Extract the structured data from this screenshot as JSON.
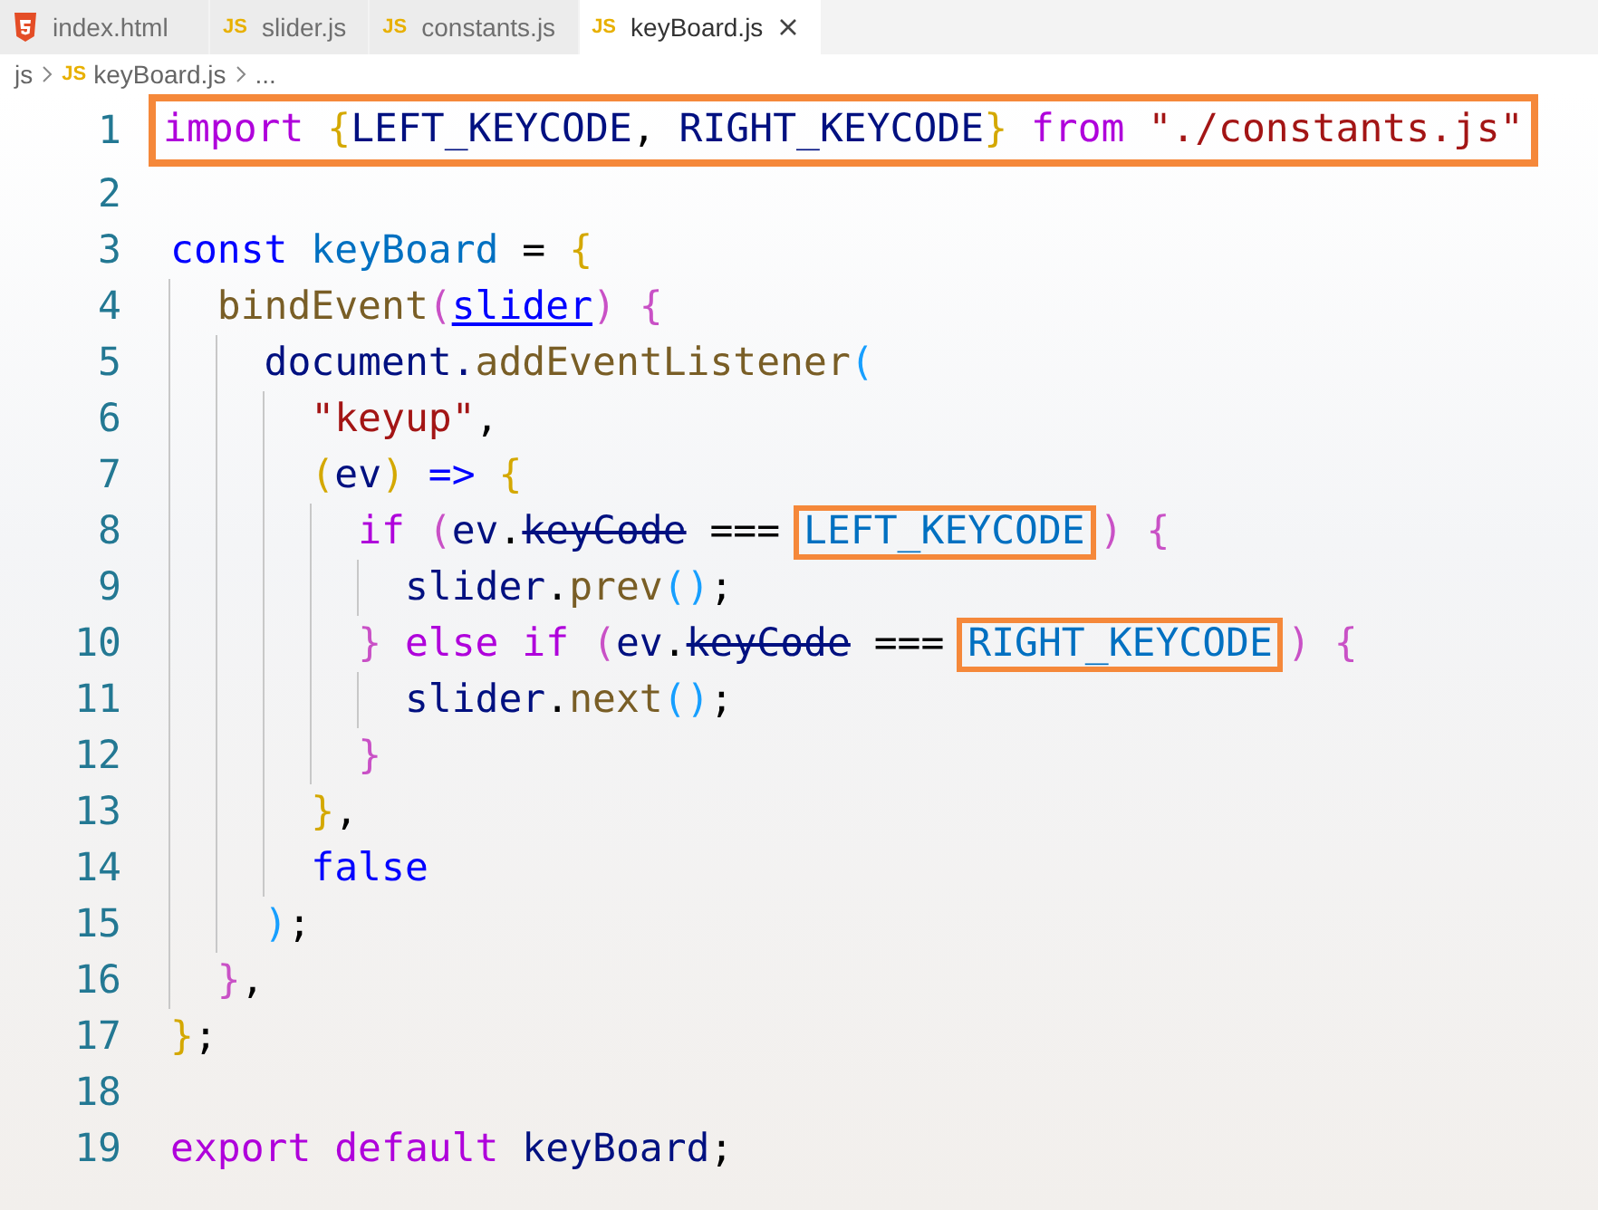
{
  "tabs": [
    {
      "label": "index.html",
      "kind": "html",
      "selected": false,
      "closable": false
    },
    {
      "label": "slider.js",
      "kind": "js",
      "badge": "JS",
      "selected": false,
      "closable": false
    },
    {
      "label": "constants.js",
      "kind": "js",
      "badge": "JS",
      "selected": false,
      "closable": false
    },
    {
      "label": "keyBoard.js",
      "kind": "js",
      "badge": "JS",
      "selected": true,
      "closable": true
    }
  ],
  "breadcrumb": [
    {
      "label": "js"
    },
    {
      "badge": "JS",
      "label": "keyBoard.js"
    },
    {
      "label": "..."
    }
  ],
  "lines": [
    {
      "number": "1",
      "highlighted": true,
      "tokens": [
        {
          "text": "import",
          "kind": "keyword"
        },
        {
          "text": " {",
          "kind": "bracket1"
        },
        {
          "text": "LEFT_KEYCODE",
          "kind": "variable"
        },
        {
          "text": ", ",
          "kind": "plain"
        },
        {
          "text": "RIGHT_KEYCODE",
          "kind": "variable"
        },
        {
          "text": "}",
          "kind": "bracket1"
        },
        {
          "text": " from",
          "kind": "keyword"
        },
        {
          "text": " \"./constants.js\"",
          "kind": "string"
        }
      ]
    },
    {
      "number": "2",
      "highlighted": false
    },
    {
      "number": "3",
      "highlighted": false,
      "tokens": [
        {
          "text": "const",
          "kind": "storage"
        },
        {
          "text": " keyBoard",
          "kind": "constant"
        },
        {
          "text": " = ",
          "kind": "plain"
        },
        {
          "text": "{",
          "kind": "bracket1"
        }
      ]
    },
    {
      "number": "4",
      "highlighted": false,
      "tokens": [
        {
          "text": "  bindEvent",
          "kind": "function"
        },
        {
          "text": "(",
          "kind": "bracket2"
        },
        {
          "text": "slider",
          "kind": "param"
        },
        {
          "text": ")",
          "kind": "bracket2"
        },
        {
          "text": " {",
          "kind": "bracket2"
        }
      ]
    },
    {
      "number": "5",
      "highlighted": false,
      "tokens": [
        {
          "text": "    document.",
          "kind": "variable"
        },
        {
          "text": "addEventListener",
          "kind": "function"
        },
        {
          "text": "(",
          "kind": "bracket3"
        }
      ]
    },
    {
      "number": "6",
      "highlighted": false,
      "tokens": [
        {
          "text": "      \"keyup\"",
          "kind": "string"
        },
        {
          "text": ",",
          "kind": "plain"
        }
      ]
    },
    {
      "number": "7",
      "highlighted": false,
      "tokens": [
        {
          "text": "      (",
          "kind": "bracket1"
        },
        {
          "text": "ev",
          "kind": "variable"
        },
        {
          "text": ")",
          "kind": "bracket1"
        },
        {
          "text": " =>",
          "kind": "storage"
        },
        {
          "text": " {",
          "kind": "bracket1"
        }
      ]
    },
    {
      "number": "8",
      "highlighted": false,
      "tokens": [
        {
          "text": "        if",
          "kind": "keyword"
        },
        {
          "text": " (",
          "kind": "bracket2"
        },
        {
          "text": "ev",
          "kind": "variable"
        },
        {
          "text": ".",
          "kind": "plain"
        },
        {
          "text": "keyCode",
          "kind": "deprecated"
        },
        {
          "text": " === ",
          "kind": "plain"
        },
        {
          "text": "LEFT_KEYCODE",
          "kind": "constant",
          "highlighted": true
        },
        {
          "text": ")",
          "kind": "bracket2"
        },
        {
          "text": " {",
          "kind": "bracket2"
        }
      ]
    },
    {
      "number": "9",
      "highlighted": false,
      "tokens": [
        {
          "text": "          slider",
          "kind": "variable"
        },
        {
          "text": ".",
          "kind": "plain"
        },
        {
          "text": "prev",
          "kind": "function"
        },
        {
          "text": "()",
          "kind": "bracket3"
        },
        {
          "text": ";",
          "kind": "plain"
        }
      ]
    },
    {
      "number": "10",
      "highlighted": false,
      "tokens": [
        {
          "text": "        }",
          "kind": "bracket2"
        },
        {
          "text": " else if",
          "kind": "keyword"
        },
        {
          "text": " (",
          "kind": "bracket2"
        },
        {
          "text": "ev",
          "kind": "variable"
        },
        {
          "text": ".",
          "kind": "plain"
        },
        {
          "text": "keyCode",
          "kind": "deprecated"
        },
        {
          "text": " === ",
          "kind": "plain"
        },
        {
          "text": "RIGHT_KEYCODE",
          "kind": "constant",
          "highlighted": true
        },
        {
          "text": ")",
          "kind": "bracket2"
        },
        {
          "text": " {",
          "kind": "bracket2"
        }
      ]
    },
    {
      "number": "11",
      "highlighted": false,
      "tokens": [
        {
          "text": "          slider",
          "kind": "variable"
        },
        {
          "text": ".",
          "kind": "plain"
        },
        {
          "text": "next",
          "kind": "function"
        },
        {
          "text": "()",
          "kind": "bracket3"
        },
        {
          "text": ";",
          "kind": "plain"
        }
      ]
    },
    {
      "number": "12",
      "highlighted": false,
      "tokens": [
        {
          "text": "        }",
          "kind": "bracket2"
        }
      ]
    },
    {
      "number": "13",
      "highlighted": false,
      "tokens": [
        {
          "text": "      }",
          "kind": "bracket1"
        },
        {
          "text": ",",
          "kind": "plain"
        }
      ]
    },
    {
      "number": "14",
      "highlighted": false,
      "tokens": [
        {
          "text": "      false",
          "kind": "storage"
        }
      ]
    },
    {
      "number": "15",
      "highlighted": false,
      "tokens": [
        {
          "text": "    )",
          "kind": "bracket3"
        },
        {
          "text": ";",
          "kind": "plain"
        }
      ]
    },
    {
      "number": "16",
      "highlighted": false,
      "tokens": [
        {
          "text": "  }",
          "kind": "bracket2"
        },
        {
          "text": ",",
          "kind": "plain"
        }
      ]
    },
    {
      "number": "17",
      "highlighted": false,
      "tokens": [
        {
          "text": "}",
          "kind": "bracket1"
        },
        {
          "text": ";",
          "kind": "plain"
        }
      ]
    },
    {
      "number": "18",
      "highlighted": false
    },
    {
      "number": "19",
      "highlighted": false,
      "tokens": [
        {
          "text": "export default",
          "kind": "keyword"
        },
        {
          "text": " keyBoard",
          "kind": "variable"
        },
        {
          "text": ";",
          "kind": "plain"
        }
      ]
    }
  ]
}
